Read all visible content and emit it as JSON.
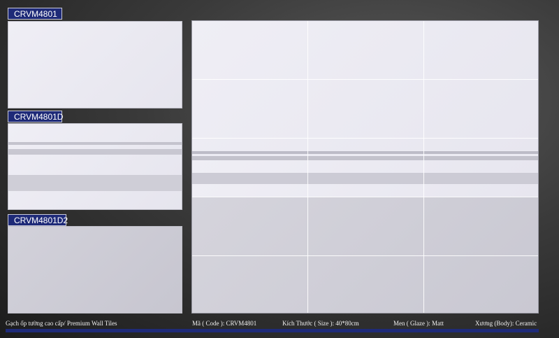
{
  "samples": [
    {
      "code": "CRVM4801"
    },
    {
      "code": "CRVM4801D"
    },
    {
      "code": "CRVM4801D2"
    }
  ],
  "footer": {
    "product": "Gạch ốp tường cao cấp/ Premium Wall Tiles",
    "code": "Mã ( Code ): CRVM4801",
    "size": "Kích Thước ( Size ): 40*80cm",
    "glaze": "Men ( Glaze ): Matt",
    "body": "Xương (Body): Ceramic"
  },
  "colors": {
    "label_bg": "#1e2a78",
    "tile_light": "#ecebf3",
    "tile_dark": "#cecdd6",
    "stripe": "#b8b7c2"
  }
}
